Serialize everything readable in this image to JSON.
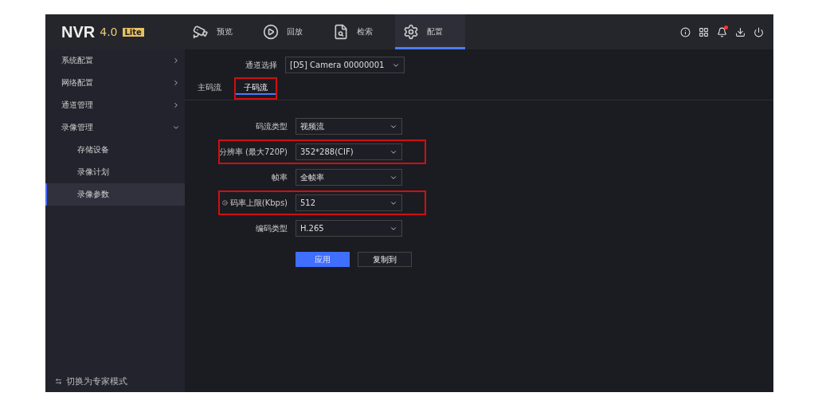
{
  "header": {
    "logo": "NVR",
    "version": "4.0",
    "edition": "Lite",
    "nav": [
      {
        "label": "预览",
        "selected": false
      },
      {
        "label": "回放",
        "selected": false
      },
      {
        "label": "检索",
        "selected": false
      },
      {
        "label": "配置",
        "selected": true
      }
    ],
    "notification_dot": true
  },
  "sidebar": {
    "items": [
      {
        "label": "系统配置",
        "expanded": false
      },
      {
        "label": "网络配置",
        "expanded": false
      },
      {
        "label": "通道管理",
        "expanded": false
      },
      {
        "label": "录像管理",
        "expanded": true,
        "children": [
          {
            "label": "存储设备",
            "selected": false
          },
          {
            "label": "录像计划",
            "selected": false
          },
          {
            "label": "录像参数",
            "selected": true
          }
        ]
      }
    ],
    "footer": "切换为专家模式"
  },
  "channel": {
    "label": "通道选择",
    "value": "[D5] Camera 00000001"
  },
  "tabs": [
    {
      "label": "主码流",
      "selected": false,
      "highlighted": false
    },
    {
      "label": "子码流",
      "selected": true,
      "highlighted": true
    }
  ],
  "fields": [
    {
      "label": "码流类型",
      "value": "视频流",
      "info": false,
      "highlighted": false
    },
    {
      "label": "分辨率 (最大720P)",
      "value": "352*288(CIF)",
      "info": false,
      "highlighted": true
    },
    {
      "label": "帧率",
      "value": "全帧率",
      "info": false,
      "highlighted": false
    },
    {
      "label": "码率上限(Kbps)",
      "value": "512",
      "info": true,
      "highlighted": true
    },
    {
      "label": "编码类型",
      "value": "H.265",
      "info": false,
      "highlighted": false
    }
  ],
  "buttons": [
    {
      "label": "应用",
      "primary": true
    },
    {
      "label": "复制到",
      "primary": false
    }
  ]
}
